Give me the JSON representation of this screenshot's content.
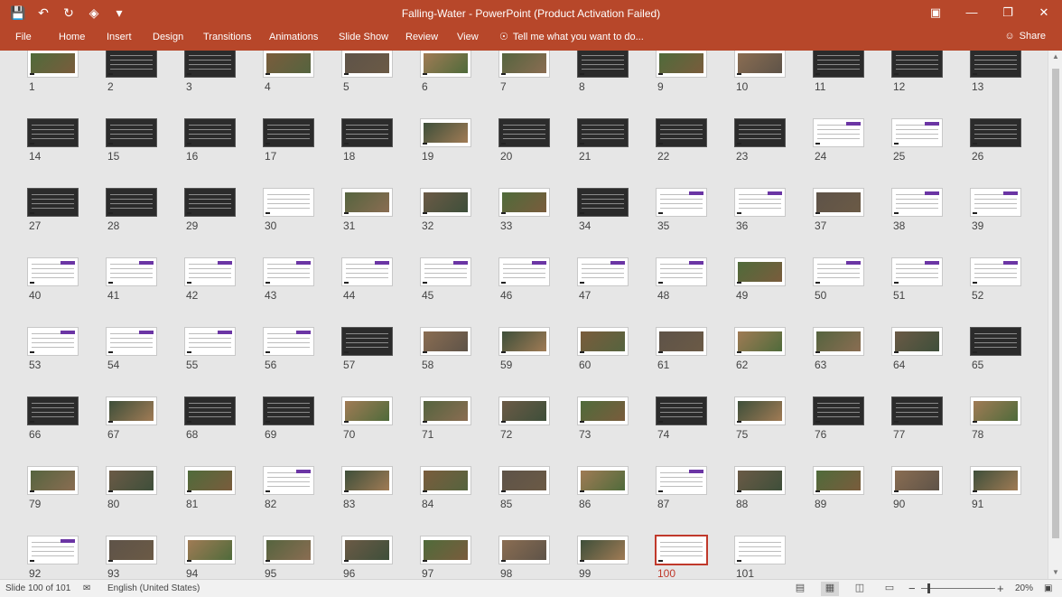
{
  "window": {
    "title": "Falling-Water - PowerPoint (Product Activation Failed)",
    "qat_icons": [
      "save-icon",
      "undo-icon",
      "redo-icon",
      "start-from-beginning-icon",
      "customize-icon"
    ],
    "controls": [
      "ribbon-display-icon",
      "minimize-icon",
      "restore-icon",
      "close-icon"
    ]
  },
  "ribbon": {
    "tabs": [
      "File",
      "Home",
      "Insert",
      "Design",
      "Transitions",
      "Animations",
      "Slide Show",
      "Review",
      "View"
    ],
    "tell_me": "Tell me what you want to do...",
    "share": "Share"
  },
  "slides": {
    "total": 101,
    "selected": 100,
    "columns": 13
  },
  "status": {
    "slide_info": "Slide 100 of 101",
    "language": "English (United States)",
    "zoom": "20%",
    "zoom_fraction": 0.2
  },
  "colors": {
    "accent": "#b7472a",
    "selection": "#c0392b",
    "purple_tag": "#6b35a4"
  }
}
